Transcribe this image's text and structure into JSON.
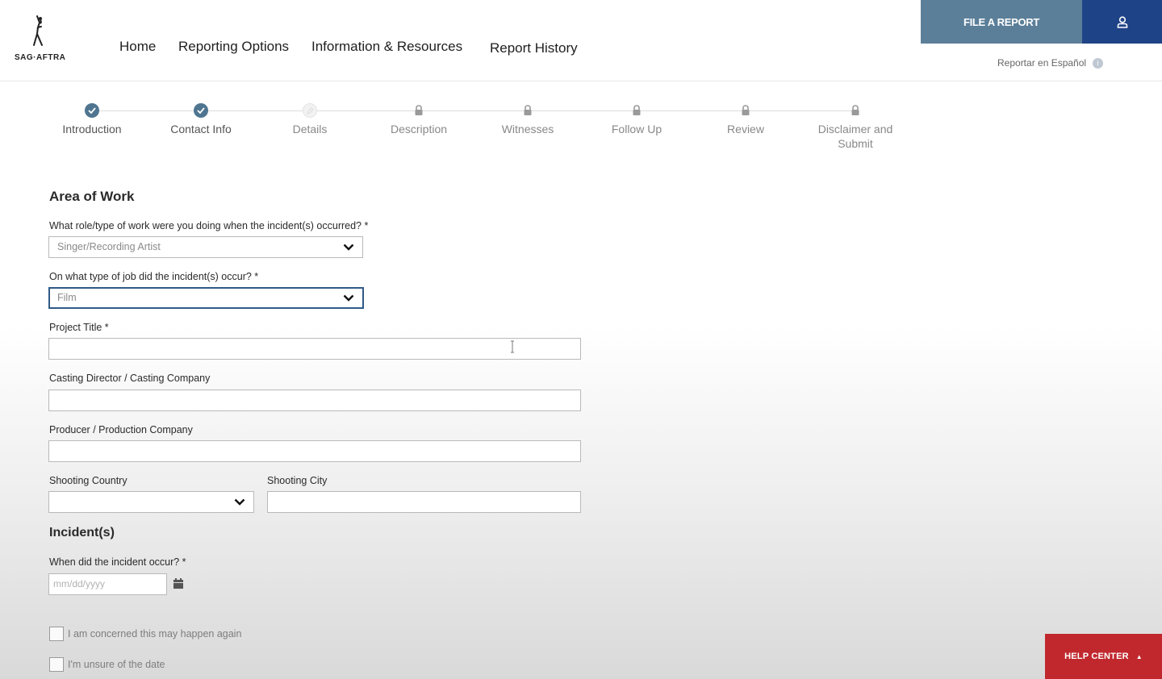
{
  "brand": {
    "logo_text": "SAG·AFTRA"
  },
  "nav": {
    "home": "Home",
    "reporting_options": "Reporting Options",
    "information_resources": "Information & Resources",
    "report_history": "Report History"
  },
  "header_actions": {
    "file_report": "FILE A REPORT",
    "espanol": "Reportar en Español"
  },
  "stepper": {
    "steps": [
      {
        "label": "Introduction",
        "status": "complete"
      },
      {
        "label": "Contact Info",
        "status": "complete"
      },
      {
        "label": "Details",
        "status": "current"
      },
      {
        "label": "Description",
        "status": "locked"
      },
      {
        "label": "Witnesses",
        "status": "locked"
      },
      {
        "label": "Follow Up",
        "status": "locked"
      },
      {
        "label": "Review",
        "status": "locked"
      },
      {
        "label": "Disclaimer and Submit",
        "status": "locked"
      }
    ]
  },
  "area_of_work": {
    "title": "Area of Work",
    "role_label": "What role/type of work were you doing when the incident(s) occurred? *",
    "role_value": "Singer/Recording Artist",
    "job_label": "On what type of job did the incident(s) occur? *",
    "job_value": "Film",
    "project_title_label": "Project Title *",
    "project_title_value": "",
    "casting_label": "Casting Director / Casting Company",
    "casting_value": "",
    "producer_label": "Producer / Production Company",
    "producer_value": "",
    "country_label": "Shooting Country",
    "country_value": "",
    "city_label": "Shooting City",
    "city_value": ""
  },
  "incidents": {
    "title": "Incident(s)",
    "date_label": "When did the incident occur? *",
    "date_placeholder": "mm/dd/yyyy",
    "concerned_label": "I am concerned this may happen again",
    "unsure_label": "I'm unsure of the date"
  },
  "help": {
    "label": "HELP CENTER"
  },
  "colors": {
    "file_report_bg": "#5b7f99",
    "user_btn_bg": "#1f4387",
    "step_complete": "#4f7590",
    "help_center_bg": "#c0282e",
    "focus_border": "#2f5a88"
  }
}
